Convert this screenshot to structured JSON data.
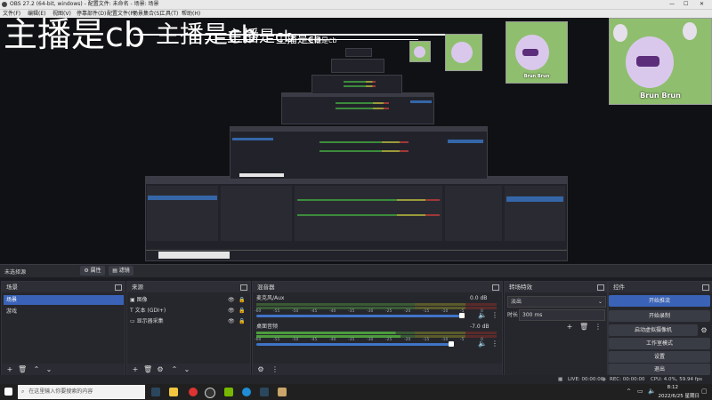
{
  "window": {
    "title": "OBS 27.2 (64-bit, windows) - 配置文件: 未命名 - 场景: 场景",
    "min": "—",
    "max": "☐",
    "close": "✕"
  },
  "menu": [
    "文件(F)",
    "编辑(E)",
    "视图(V)",
    "停靠部件(D)",
    "配置文件(P)",
    "场景集合(S)",
    "工具(T)",
    "帮助(H)"
  ],
  "preview": {
    "overlay_text": "主播是cb",
    "mascot_caption": "Brun Brun"
  },
  "scene_bar": {
    "label": "未选择源",
    "properties": "属性",
    "filters": "滤镜"
  },
  "scenes": {
    "title": "场景",
    "items": [
      "场景",
      "游戏"
    ],
    "selected": 0
  },
  "sources": {
    "title": "来源",
    "items": [
      {
        "name": "图像",
        "icon": "image-icon"
      },
      {
        "name": "文本 (GDI+)",
        "icon": "text-icon"
      },
      {
        "name": "显示器采集",
        "icon": "monitor-icon"
      }
    ]
  },
  "mixer": {
    "title": "混音器",
    "ticks": [
      "-60",
      "-55",
      "-50",
      "-45",
      "-40",
      "-35",
      "-30",
      "-25",
      "-20",
      "-15",
      "-10",
      "-5",
      "0"
    ],
    "channels": [
      {
        "name": "麦克风/Aux",
        "db": "0.0 dB",
        "level": 0.0
      },
      {
        "name": "桌面音频",
        "db": "-7.0 dB",
        "level": 0.92
      }
    ]
  },
  "transitions": {
    "title": "转场特效",
    "selected": "淡出",
    "duration_label": "时长",
    "duration_value": "300 ms"
  },
  "controls": {
    "title": "控件",
    "buttons": [
      "开始推流",
      "开始录制",
      "启动虚拟摄像机",
      "工作室模式",
      "设置",
      "退出"
    ]
  },
  "status": {
    "live": "LIVE: 00:00:00",
    "rec": "REC: 00:00:00",
    "cpu": "CPU: 4.0%, 59.94 fps"
  },
  "taskbar": {
    "search_placeholder": "在这里输入你要搜索的内容",
    "time": "8:12",
    "date": "2022/6/25 星期日"
  },
  "colors": {
    "accent": "#3a63b8",
    "meter_green": "#4c9c3c",
    "meter_yellow": "#b8b83c",
    "meter_red": "#b83c3c"
  }
}
